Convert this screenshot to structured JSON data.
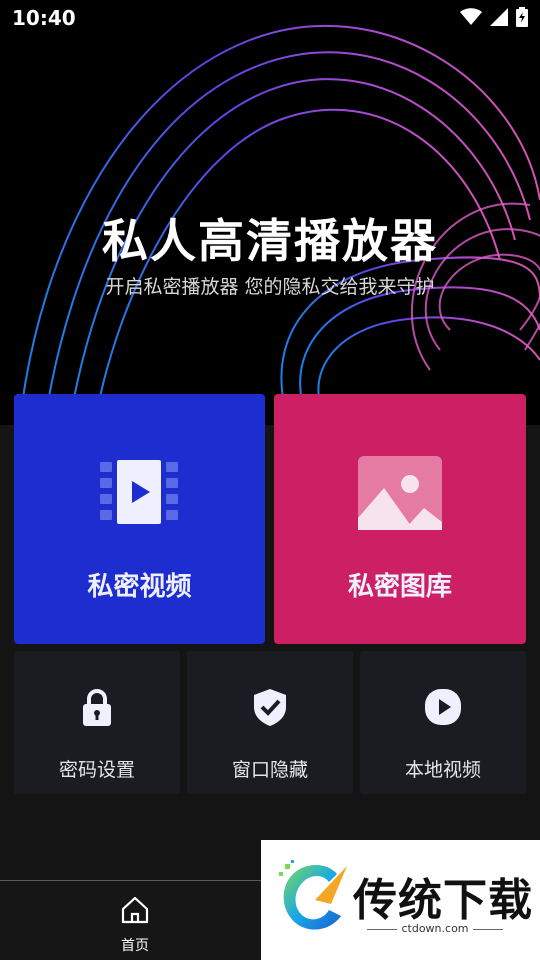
{
  "status_bar": {
    "time": "10:40"
  },
  "hero": {
    "title": "私人高清播放器",
    "subtitle": "开启私密播放器 您的隐私交给我来守护"
  },
  "cards": {
    "private_video": {
      "label": "私密视频",
      "color": "#1e2dcf",
      "icon": "video-icon"
    },
    "private_gallery": {
      "label": "私密图库",
      "color": "#cd1f63",
      "icon": "image-icon"
    }
  },
  "tiles": [
    {
      "label": "密码设置",
      "icon": "lock-icon"
    },
    {
      "label": "窗口隐藏",
      "icon": "shield-check-icon"
    },
    {
      "label": "本地视频",
      "icon": "play-icon"
    }
  ],
  "bottom_nav": {
    "home_label": "首页",
    "home_icon": "home-icon"
  },
  "watermark": {
    "text": "传统下载",
    "url": "ctdown.com"
  }
}
